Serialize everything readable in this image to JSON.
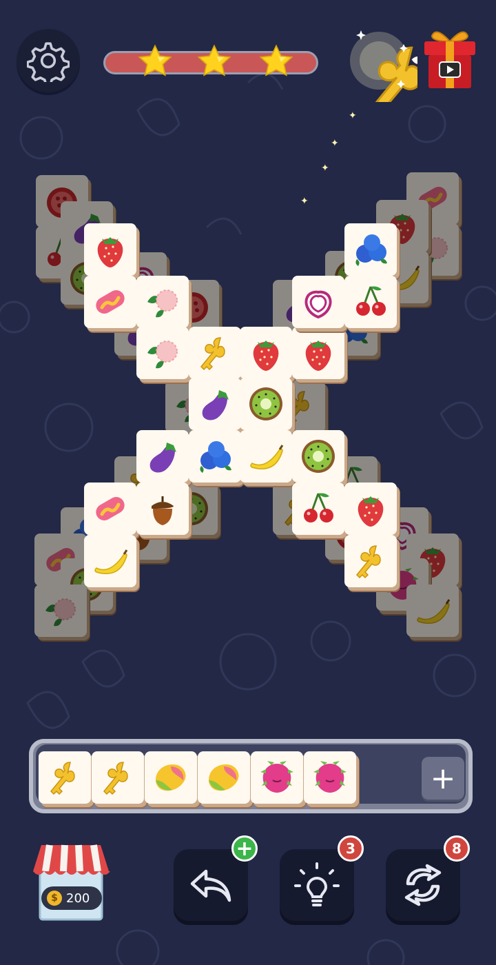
{
  "level": {
    "stars": 3,
    "progress_color": "#c95757"
  },
  "colors": {
    "background": "#222846",
    "tile_face": "#fff9f0",
    "tile_edge": "#9a6f50",
    "badge_red": "#d0463e",
    "badge_green": "#3cb54a"
  },
  "board": {
    "tile_icons": [
      "strawberry",
      "eggplant",
      "pomegranate",
      "cherry",
      "kiwi",
      "hotdog",
      "lychee",
      "key",
      "blueberry",
      "banana",
      "acorn",
      "onion",
      "dragonfruit",
      "mango"
    ]
  },
  "tray": {
    "slots": [
      "key-icon",
      "key-icon",
      "mango-icon",
      "mango-icon",
      "dragonfruit-icon",
      "dragonfruit-icon"
    ],
    "add_label": "+"
  },
  "shop": {
    "coins": "200",
    "coin_symbol": "$"
  },
  "tools": {
    "undo_badge": "+",
    "hint_badge": "3",
    "shuffle_badge": "8"
  }
}
